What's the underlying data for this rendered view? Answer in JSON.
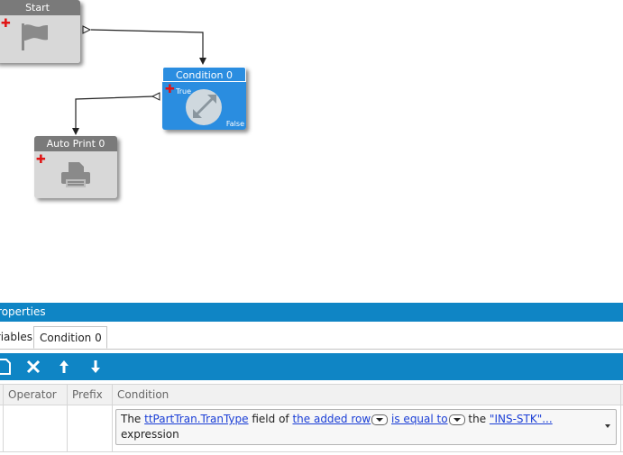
{
  "workflow": {
    "nodes": {
      "start": {
        "title": "Start",
        "icon": "flag-icon"
      },
      "condition": {
        "title": "Condition 0",
        "icon": "condition-icon",
        "true_label": "True",
        "false_label": "False"
      },
      "auto_print": {
        "title": "Auto Print 0",
        "icon": "printer-icon"
      }
    }
  },
  "properties": {
    "title": "Properties",
    "tabs": [
      {
        "label": "Variables"
      },
      {
        "label": "Condition 0"
      }
    ],
    "toolbar": {
      "new_icon": "new-icon",
      "delete_icon": "delete-icon",
      "up_icon": "move-up-icon",
      "down_icon": "move-down-icon"
    },
    "columns": [
      "Operator",
      "Prefix",
      "Condition"
    ],
    "rows": [
      {
        "operator": "",
        "prefix": "",
        "condition": {
          "t1": "The ",
          "field": "ttPartTran.TranType",
          "t2": " field of ",
          "row_kind": "the added row",
          "t3": " ",
          "comparison": "is equal to",
          "t4": " the ",
          "value": "\"INS-STK\"...",
          "t5": "expression"
        }
      }
    ]
  },
  "colors": {
    "accent": "#0f85c5",
    "condition_node": "#2a8de0",
    "node_gray": "#d8d8d8",
    "link": "#1a3ed6"
  }
}
